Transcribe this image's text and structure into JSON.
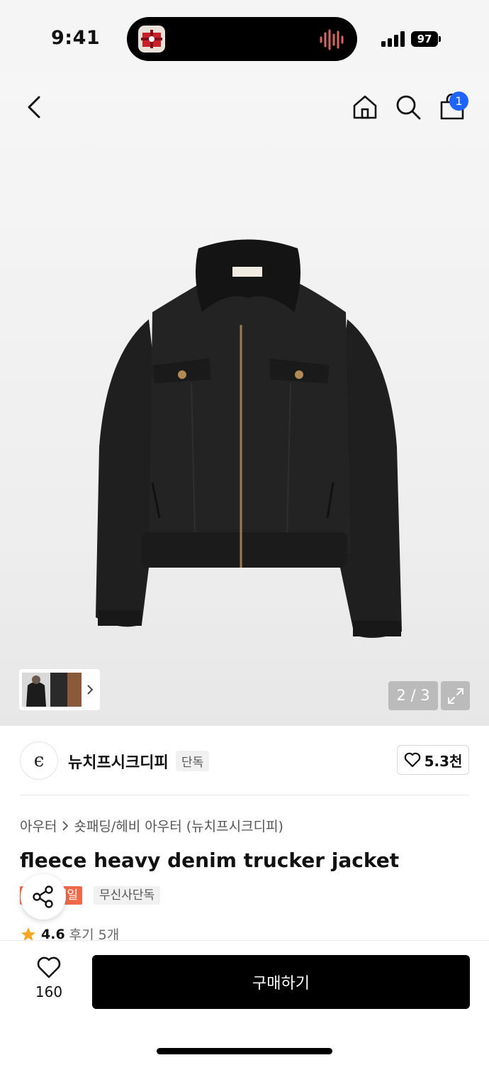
{
  "status_bar": {
    "time": "9:41",
    "battery": "97"
  },
  "header": {
    "back_icon": "chevron-left-icon",
    "home_icon": "home-icon",
    "search_icon": "search-icon",
    "cart_icon": "shopping-bag-icon",
    "cart_count": "1"
  },
  "gallery": {
    "counter": "2 / 3",
    "expand_icon": "expand-icon"
  },
  "brand": {
    "logo_text": "ϵ",
    "name": "뉴치프시크디피",
    "tag": "단독",
    "likes": "5.3천"
  },
  "product": {
    "breadcrumb": [
      "아우터",
      "숏패딩/헤비 아우터 (뉴치프시크디피)"
    ],
    "title": "fleece heavy denim trucker jacket",
    "badges": {
      "sale": "세일",
      "exclusive": "무신사단독"
    },
    "rating": "4.6",
    "reviews": "후기 5개"
  },
  "bottom_bar": {
    "wish_count": "160",
    "buy_label": "구매하기"
  },
  "colors": {
    "accent_blue": "#1e64ff",
    "sale_red": "#f06a4a",
    "star": "#f5a623"
  }
}
